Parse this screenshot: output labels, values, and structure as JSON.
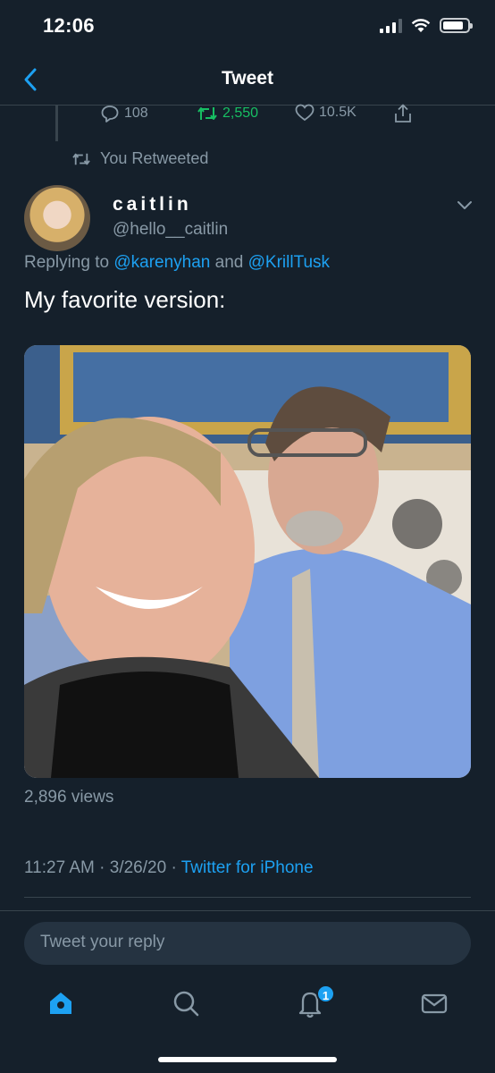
{
  "status_bar": {
    "time": "12:06"
  },
  "nav": {
    "title": "Tweet"
  },
  "prev_tweet_actions": {
    "replies": "108",
    "retweets": "2,550",
    "likes": "10.5K"
  },
  "retweet_context": {
    "text": "You Retweeted"
  },
  "tweet": {
    "display_name": "caitlin",
    "handle": "@hello__caitlin",
    "replying_prefix": "Replying to",
    "mention_1": "@karenyhan",
    "and_text": "and",
    "mention_2": "@KrillTusk",
    "text": "My favorite version:",
    "views": "2,896 views",
    "time": "11:27 AM",
    "date": "3/26/20",
    "separator": "·",
    "source": "Twitter for iPhone"
  },
  "reply_box": {
    "placeholder": "Tweet your reply"
  },
  "tab_bar": {
    "notifications_badge": "1"
  },
  "colors": {
    "background": "#15202b",
    "accent": "#1da1f2",
    "retweet_green": "#17bf63",
    "muted": "#8899a6"
  },
  "icons": [
    "back-chevron-icon",
    "reply-icon",
    "retweet-icon",
    "like-icon",
    "share-icon",
    "home-icon",
    "search-icon",
    "notifications-icon",
    "messages-icon"
  ]
}
